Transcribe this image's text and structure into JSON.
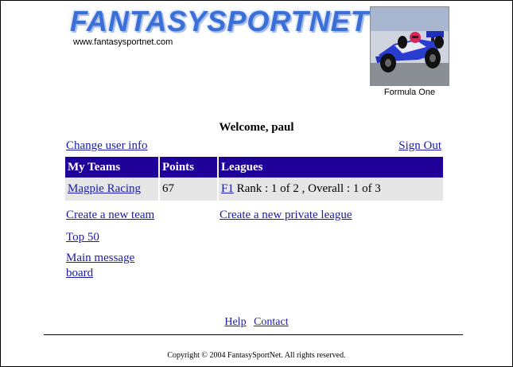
{
  "header": {
    "logo_text": "FANTASYSPORTNET",
    "url_text": "www.fantasysportnet.com",
    "sport_caption": "Formula One"
  },
  "account": {
    "welcome": "Welcome, paul",
    "change_user_info": "Change user info",
    "sign_out": "Sign Out"
  },
  "teams_table": {
    "headers": [
      "My Teams",
      "Points",
      "Leagues"
    ],
    "rows": [
      {
        "team": "Magpie Racing",
        "points": "67",
        "league_link": "F1",
        "league_rank": " Rank : 1 of 2 , Overall : 1 of 3"
      }
    ]
  },
  "actions": {
    "create_team": "Create a new team",
    "create_league": "Create a new private league",
    "top50": "Top 50",
    "message_board": "Main message board"
  },
  "footer": {
    "help": "Help",
    "contact": "Contact",
    "copyright": "Copyright © 2004 FantasySportNet. All rights reserved."
  }
}
